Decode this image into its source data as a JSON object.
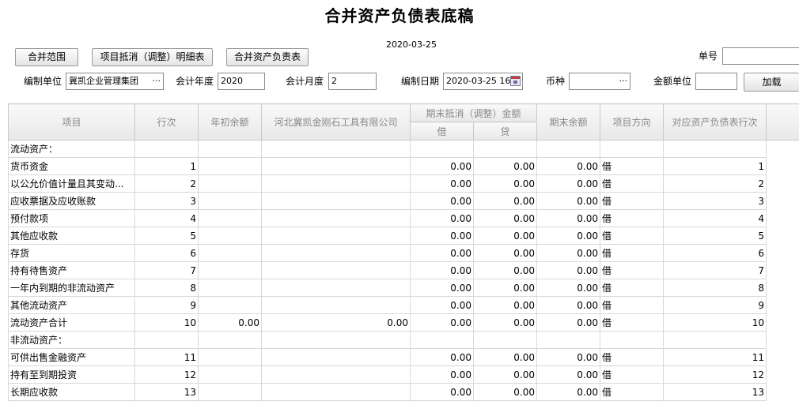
{
  "title": "合并资产负债表底稿",
  "report_date": "2020-03-25",
  "toolbar": {
    "scope_label": "合并范围",
    "elimination_label": "项目抵消（调整）明细表",
    "consolidated_label": "合并资产负责表"
  },
  "doc_no": {
    "label": "单号",
    "value": ""
  },
  "filters": {
    "unit_label": "编制单位",
    "unit_value": "冀凯企业管理集团",
    "year_label": "会计年度",
    "year_value": "2020",
    "month_label": "会计月度",
    "month_value": "2",
    "date_label": "编制日期",
    "date_value": "2020-03-25 16",
    "currency_label": "币种",
    "currency_value": "",
    "amount_unit_label": "金额单位",
    "amount_unit_value": "",
    "load_label": "加载"
  },
  "table": {
    "headers": {
      "item": "项目",
      "line": "行次",
      "opening": "年初余额",
      "company": "河北冀凯金刚石工具有限公司",
      "elim": "期末抵消（调整）金额",
      "debit": "借",
      "credit": "贷",
      "closing": "期末余额",
      "direction": "项目方向",
      "mapping": "对应资产负债表行次"
    },
    "rows": [
      {
        "item": "流动资产：",
        "line": "",
        "opening": "",
        "company": "",
        "debit": "",
        "credit": "",
        "closing": "",
        "direction": "",
        "mapping": ""
      },
      {
        "item": "货币资金",
        "line": "1",
        "opening": "",
        "company": "",
        "debit": "0.00",
        "credit": "0.00",
        "closing": "0.00",
        "direction": "借",
        "mapping": "1"
      },
      {
        "item": "以公允价值计量且其变动...",
        "line": "2",
        "opening": "",
        "company": "",
        "debit": "0.00",
        "credit": "0.00",
        "closing": "0.00",
        "direction": "借",
        "mapping": "2"
      },
      {
        "item": "应收票据及应收账款",
        "line": "3",
        "opening": "",
        "company": "",
        "debit": "0.00",
        "credit": "0.00",
        "closing": "0.00",
        "direction": "借",
        "mapping": "3"
      },
      {
        "item": "预付款项",
        "line": "4",
        "opening": "",
        "company": "",
        "debit": "0.00",
        "credit": "0.00",
        "closing": "0.00",
        "direction": "借",
        "mapping": "4"
      },
      {
        "item": "其他应收款",
        "line": "5",
        "opening": "",
        "company": "",
        "debit": "0.00",
        "credit": "0.00",
        "closing": "0.00",
        "direction": "借",
        "mapping": "5"
      },
      {
        "item": "存货",
        "line": "6",
        "opening": "",
        "company": "",
        "debit": "0.00",
        "credit": "0.00",
        "closing": "0.00",
        "direction": "借",
        "mapping": "6"
      },
      {
        "item": "持有待售资产",
        "line": "7",
        "opening": "",
        "company": "",
        "debit": "0.00",
        "credit": "0.00",
        "closing": "0.00",
        "direction": "借",
        "mapping": "7"
      },
      {
        "item": "一年内到期的非流动资产",
        "line": "8",
        "opening": "",
        "company": "",
        "debit": "0.00",
        "credit": "0.00",
        "closing": "0.00",
        "direction": "借",
        "mapping": "8"
      },
      {
        "item": "其他流动资产",
        "line": "9",
        "opening": "",
        "company": "",
        "debit": "0.00",
        "credit": "0.00",
        "closing": "0.00",
        "direction": "借",
        "mapping": "9"
      },
      {
        "item": "流动资产合计",
        "line": "10",
        "opening": "0.00",
        "company": "0.00",
        "debit": "0.00",
        "credit": "0.00",
        "closing": "0.00",
        "direction": "借",
        "mapping": "10"
      },
      {
        "item": "非流动资产：",
        "line": "",
        "opening": "",
        "company": "",
        "debit": "",
        "credit": "",
        "closing": "",
        "direction": "",
        "mapping": ""
      },
      {
        "item": "可供出售金融资产",
        "line": "11",
        "opening": "",
        "company": "",
        "debit": "0.00",
        "credit": "0.00",
        "closing": "0.00",
        "direction": "借",
        "mapping": "11"
      },
      {
        "item": "持有至到期投资",
        "line": "12",
        "opening": "",
        "company": "",
        "debit": "0.00",
        "credit": "0.00",
        "closing": "0.00",
        "direction": "借",
        "mapping": "12"
      },
      {
        "item": "长期应收款",
        "line": "13",
        "opening": "",
        "company": "",
        "debit": "0.00",
        "credit": "0.00",
        "closing": "0.00",
        "direction": "借",
        "mapping": "13"
      }
    ]
  }
}
